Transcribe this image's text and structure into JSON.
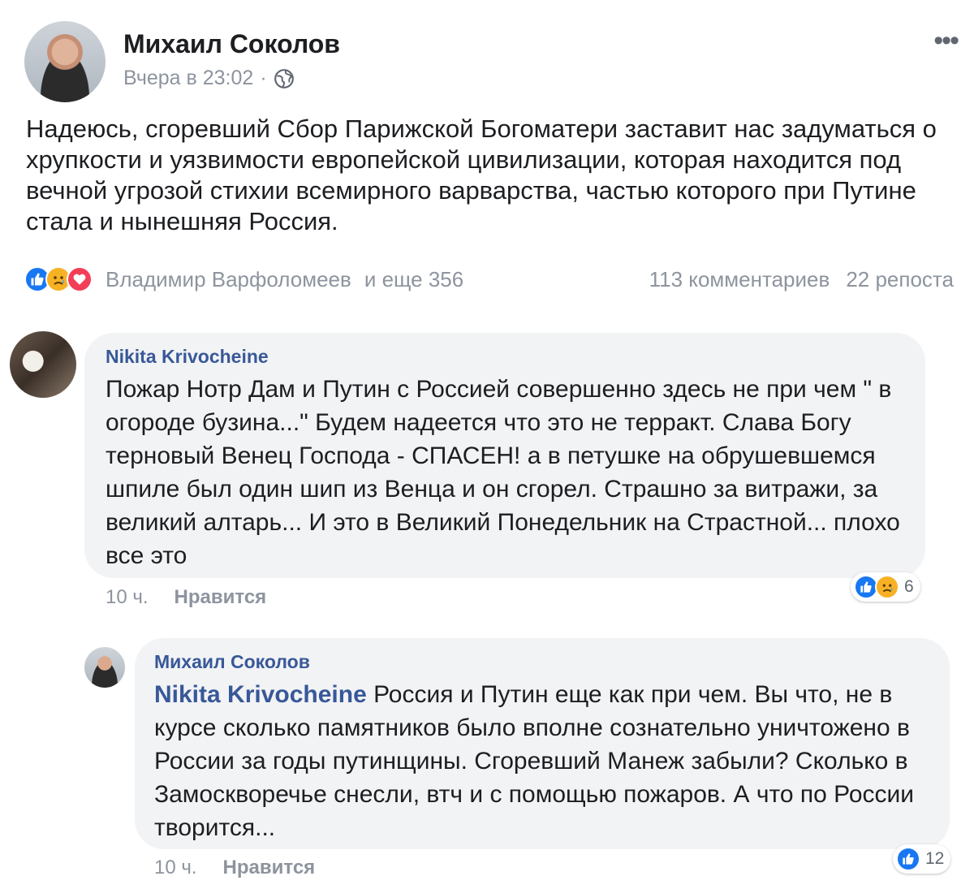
{
  "post": {
    "author": "Михаил Соколов",
    "time": "Вчера в 23:02",
    "separator": "·",
    "text": "Надеюсь, сгоревший Сбор Парижской Богоматери заставит нас задуматься о хрупкости и уязвимости европейской цивилизации, которая находится под вечной угрозой стихии всемирного варварства, частью которого при Путине стала и нынешняя Россия.",
    "reactions_names": "Владимир Варфоломеев",
    "reactions_more": "и еще 356",
    "comments_count": "113 комментариев",
    "shares_count": "22 репоста",
    "reaction_icons": [
      "like-icon",
      "sad-icon",
      "love-icon"
    ]
  },
  "comments": [
    {
      "author": "Nikita Krivocheine",
      "text": "Пожар Нотр Дам и Путин с Россией совершенно   здесь не при чем \" в огороде бузина...\" Будем надеется что это не терракт. Слава Богу терновый Венец Господа - СПАСЕН! а в петушке на обрушевшемся шпиле был один шип из Венца и он сгорел. Страшно за витражи, за великий алтарь... И это в Великий Понедельник на Страстной... плохо все это",
      "time": "10 ч.",
      "like_label": "Нравится",
      "reaction_count": "6"
    },
    {
      "author": "Михаил Соколов",
      "mention": "Nikita Krivocheine",
      "text": "Россия и Путин еще как при чем. Вы что, не в курсе сколько памятников было вполне сознательно уничтожено в России за годы путинщины. Сгоревший Манеж забыли? Сколько в Замоскворечье снесли, втч и с помощью пожаров. А что по России творится...",
      "time": "10 ч.",
      "like_label": "Нравится",
      "reaction_count": "12"
    }
  ],
  "colors": {
    "like": "#1877f2",
    "sad": "#f7b125",
    "love": "#f33e58",
    "meta_gray": "#8d949e",
    "bubble": "#f2f3f5"
  }
}
